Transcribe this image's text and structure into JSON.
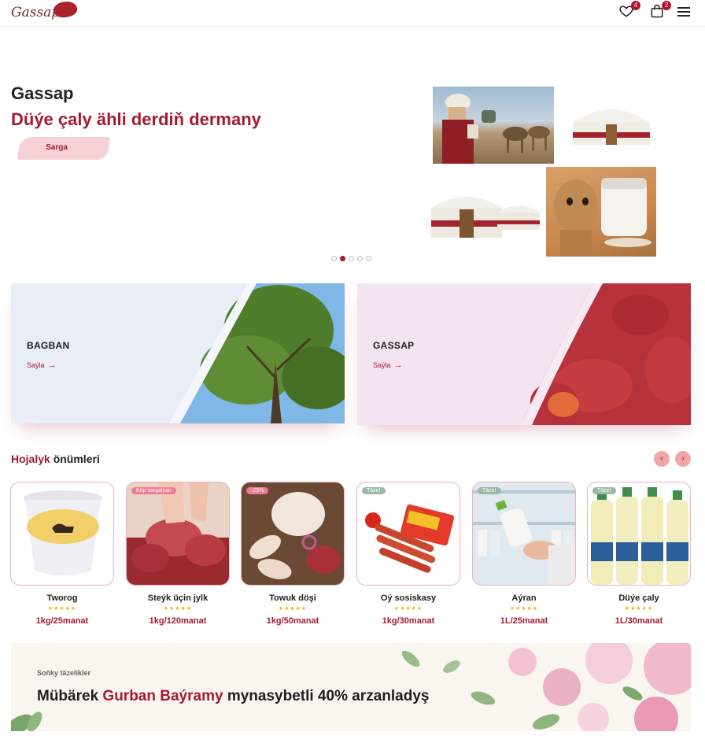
{
  "brand": {
    "logo_text": "Gassap"
  },
  "header": {
    "wishlist_count": "4",
    "cart_count": "2"
  },
  "hero": {
    "kicker": "Gassap",
    "title": "Düýe çaly ähli derdiň dermany",
    "button_label": "Sarga",
    "slides": 5,
    "active_slide": 2
  },
  "categories": [
    {
      "title": "BAGBAN",
      "link": "Saýla",
      "arrow": "→"
    },
    {
      "title": "GASSAP",
      "link": "Saýla",
      "arrow": "→"
    }
  ],
  "products_section": {
    "title_accent": "Hojalyk",
    "title_rest": " önümleri",
    "prev_icon": "‹",
    "next_icon": "›"
  },
  "products": [
    {
      "name": "Tworog",
      "price": "1kg/25manat",
      "stars": "★★★★★",
      "tag": ""
    },
    {
      "name": "Steýk üçin jylk",
      "price": "1kg/120manat",
      "stars": "★★★★★",
      "tag": "Köp sargalýan"
    },
    {
      "name": "Towuk döşi",
      "price": "1kg/50manat",
      "stars": "★★★★★",
      "tag": "-25%"
    },
    {
      "name": "Oý sosiskasy",
      "price": "1kg/30manat",
      "stars": "★★★★★",
      "tag": "Täze!"
    },
    {
      "name": "Aýran",
      "price": "1L/25manat",
      "stars": "★★★★★",
      "tag": "Täze!"
    },
    {
      "name": "Düýe çaly",
      "price": "1L/30manat",
      "stars": "★★★★★",
      "tag": "Täze!"
    }
  ],
  "promo": {
    "kicker": "Soňky täzelikler",
    "title_a": "Mübärek ",
    "title_accent": "Gurban Baýramy",
    "title_b": " mynasybetli 40% arzanladyş"
  },
  "colors": {
    "accent": "#a51a33",
    "badge": "#b3122a",
    "tag_pink": "#f07a93",
    "tag_green": "#9ab9a4"
  }
}
